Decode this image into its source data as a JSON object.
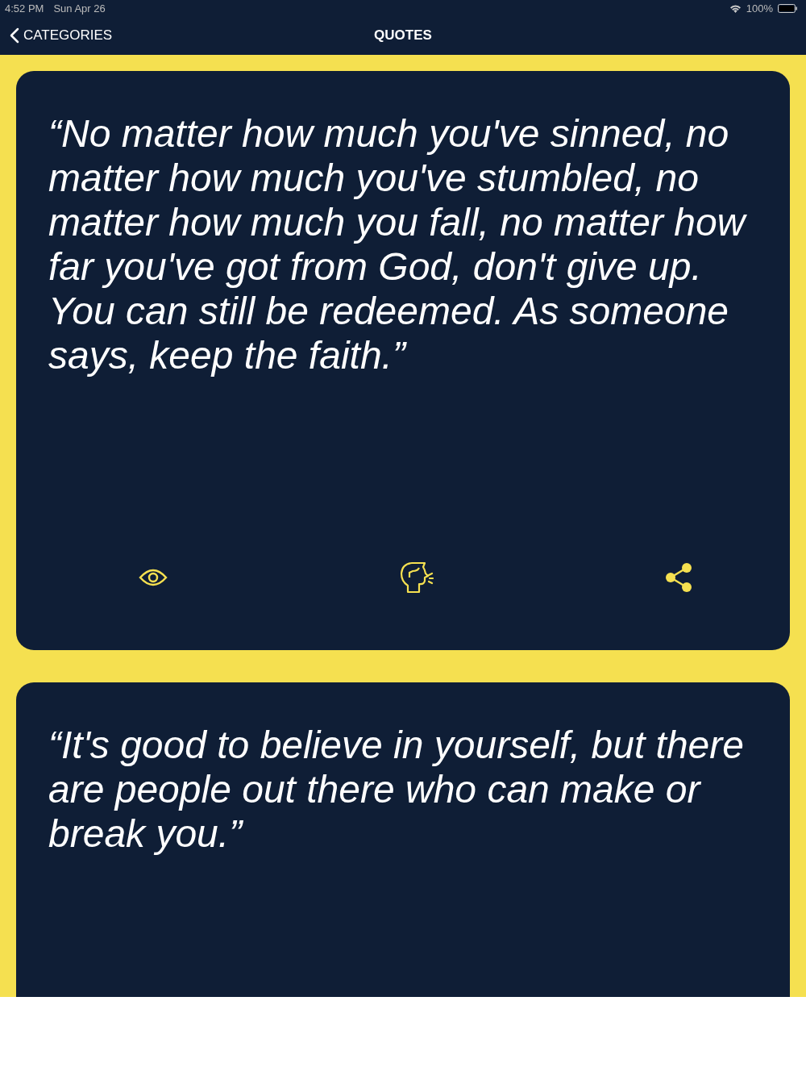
{
  "status_bar": {
    "time": "4:52 PM",
    "date": "Sun Apr 26",
    "battery": "100%"
  },
  "nav": {
    "back_label": "CATEGORIES",
    "title": "QUOTES"
  },
  "quotes": [
    {
      "text": "“No matter how much you've sinned, no matter how much you've stumbled, no matter how much you fall, no matter how far you've got from God, don't give up. You can still be redeemed. As someone says, keep the faith.”"
    },
    {
      "text": "“It's good to believe in yourself, but there are people out there who can make or break you.”"
    }
  ]
}
